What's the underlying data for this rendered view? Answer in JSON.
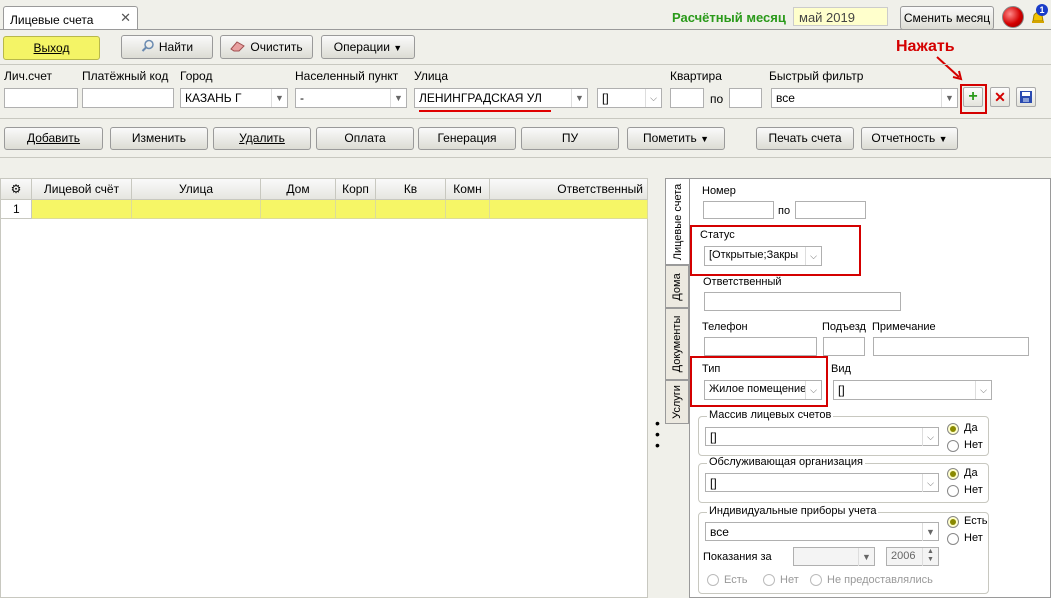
{
  "tab": {
    "title": "Лицевые счета",
    "close": "✕"
  },
  "month": {
    "label": "Расчётный месяц",
    "value": "май 2019",
    "change_button": "Сменить месяц",
    "badge": "1"
  },
  "toolbar": {
    "exit": "Выход",
    "find": "Найти",
    "clear": "Очистить",
    "operations": "Операции"
  },
  "hint": "Нажать",
  "filters": {
    "acc_label": "Лич.счет",
    "pay_label": "Платёжный код",
    "city_label": "Город",
    "city_value": "КАЗАНЬ Г",
    "settlement_label": "Населенный пункт",
    "settlement_value": "-",
    "street_label": "Улица",
    "street_value": "ЛЕНИНГРАДСКАЯ УЛ",
    "house_value": "[]",
    "flat_label": "Квартира",
    "flat_to": "по",
    "quick_label": "Быстрый фильтр",
    "quick_value": "все"
  },
  "actions": {
    "add": "Добавить",
    "edit": "Изменить",
    "delete": "Удалить",
    "payment": "Оплата",
    "generation": "Генерация",
    "pu": "ПУ",
    "mark": "Пометить",
    "print": "Печать счета",
    "report": "Отчетность"
  },
  "grid": {
    "columns": [
      "Лицевой счёт",
      "Улица",
      "Дом",
      "Корп",
      "Кв",
      "Комн",
      "Ответственный"
    ],
    "row_number": "1"
  },
  "vtabs": [
    "Лицевые счета",
    "Дома",
    "Документы",
    "Услуги"
  ],
  "panel": {
    "number_label": "Номер",
    "number_to": "по",
    "status_label": "Статус",
    "status_value": "[Открытые;Закры",
    "resp_label": "Ответственный",
    "phone_label": "Телефон",
    "entrance_label": "Подъезд",
    "note_label": "Примечание",
    "type_label": "Тип",
    "type_value": "Жилое помещение",
    "kind_label": "Вид",
    "kind_value": "[]",
    "massiv_title": "Массив лицевых счетов",
    "massiv_value": "[]",
    "org_title": "Обслуживающая организация",
    "org_value": "[]",
    "yes": "Да",
    "no": "Нет",
    "ipu_title": "Индивидуальные приборы учета",
    "ipu_value": "все",
    "ipu_yes": "Есть",
    "ipu_no": "Нет",
    "readings_label": "Показания за",
    "year": "2006",
    "r_yes": "Есть",
    "r_no": "Нет",
    "r_never": "Не предоставлялись"
  }
}
